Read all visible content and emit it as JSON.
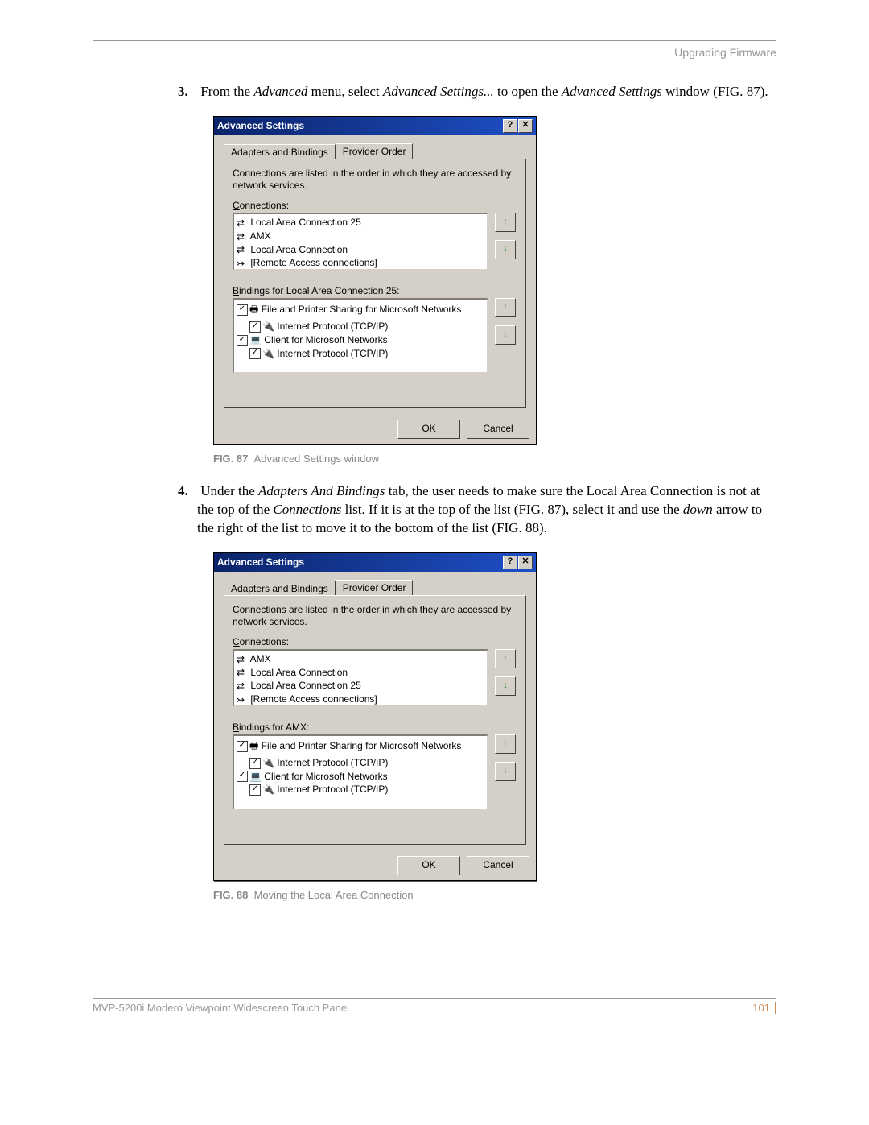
{
  "header": {
    "section_title": "Upgrading Firmware"
  },
  "steps": {
    "s3": {
      "num": "3.",
      "t1": "From the ",
      "i1": "Advanced",
      "t2": " menu, select ",
      "i2": "Advanced Settings...",
      "t3": " to open the ",
      "i3": "Advanced Settings",
      "t4": " window (FIG. 87)."
    },
    "s4": {
      "num": "4.",
      "t1": "Under the ",
      "i1": "Adapters And Bindings",
      "t2": " tab, the user needs to make sure the Local Area Connection is not at the top of the ",
      "i2": "Connections",
      "t3": " list. If it is at the top of the list (FIG. 87), select it and use the ",
      "i3": "down",
      "t4": " arrow to the right of the list to move it to the bottom of the list (FIG. 88)."
    }
  },
  "captions": {
    "c87": {
      "fig": "FIG. 87",
      "txt": "Advanced Settings window"
    },
    "c88": {
      "fig": "FIG. 88",
      "txt": "Moving the Local Area Connection"
    }
  },
  "dialog": {
    "title": "Advanced Settings",
    "help": "?",
    "close": "✕",
    "tabs": {
      "active": "Adapters and Bindings",
      "inactive": "Provider Order"
    },
    "desc": "Connections are listed in the order in which they are accessed by network services.",
    "connections_label": "Connections:",
    "bindings_label_fmt1": "Bindings for Local Area Connection 25:",
    "bindings_label_fmt2": "Bindings for AMX:",
    "ok": "OK",
    "cancel": "Cancel",
    "conn87": [
      "Local Area Connection 25",
      "AMX",
      "Local Area Connection",
      "[Remote Access connections]"
    ],
    "conn88": [
      "AMX",
      "Local Area Connection",
      "Local Area Connection 25",
      "[Remote Access connections]"
    ],
    "bindings87": {
      "a": "File and Printer Sharing for Microsoft Networks",
      "b": "Internet Protocol (TCP/IP)",
      "c": "Client for Microsoft Networks",
      "d": "Internet Protocol (TCP/IP)"
    },
    "bindings88": {
      "a": "File and Printer Sharing for Microsoft Networks",
      "b": "Internet Protocol (TCP/IP)",
      "c": "Client for Microsoft Networks",
      "d": "Internet Protocol (TCP/IP)"
    }
  },
  "footer": {
    "product": "MVP-5200i Modero Viewpoint Widescreen Touch Panel",
    "page": "101"
  }
}
